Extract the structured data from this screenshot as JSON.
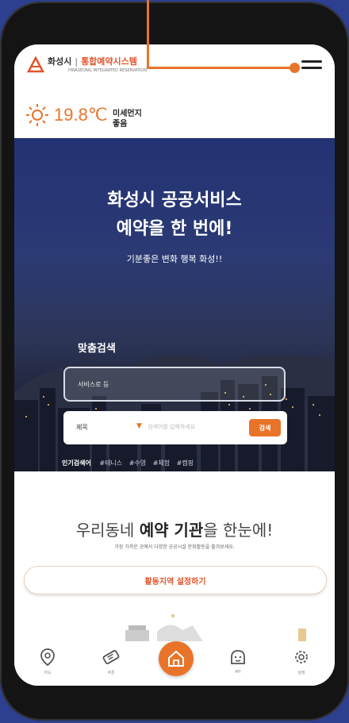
{
  "header": {
    "logo_city": "화성시",
    "logo_service": "통합예약시스템",
    "logo_sub": "HWASEONG INTEGRATED RESERVATION"
  },
  "weather": {
    "temperature": "19.8℃",
    "dust_label": "미세먼지",
    "dust_value": "좋음"
  },
  "hero": {
    "title_line1": "화성시 공공서비스",
    "title_line2": "예약을 한 번에!",
    "subtitle": "기분좋은 변화 행복 화성!!",
    "search_label": "맞춤검색",
    "search_placeholder": "서비스로 등",
    "filter_label": "제목",
    "filter_placeholder": "검색어를 입력하세요",
    "search_button": "검색",
    "popular_title": "인기검색어",
    "popular_tags": [
      "#테니스",
      "#수영",
      "#체험",
      "#캠핑"
    ]
  },
  "section": {
    "title_prefix": "우리동네 ",
    "title_bold": "예약 기관",
    "title_suffix": "을 한눈에!",
    "description": "가장 가까운 곳에서 다양한 공공시설 문화활동을 즐겨보세요.",
    "region_button": "활동지역 설정하기"
  },
  "nav": {
    "items": [
      {
        "label": "지도",
        "icon": "map-pin-icon"
      },
      {
        "label": "쿠폰",
        "icon": "ticket-icon"
      },
      {
        "label": "홈",
        "icon": "home-icon"
      },
      {
        "label": "MY",
        "icon": "face-icon"
      },
      {
        "label": "설정",
        "icon": "gear-icon"
      }
    ]
  },
  "colors": {
    "accent": "#e8742a",
    "brand_red": "#e2542b",
    "hero_blue": "#2b3a74"
  }
}
